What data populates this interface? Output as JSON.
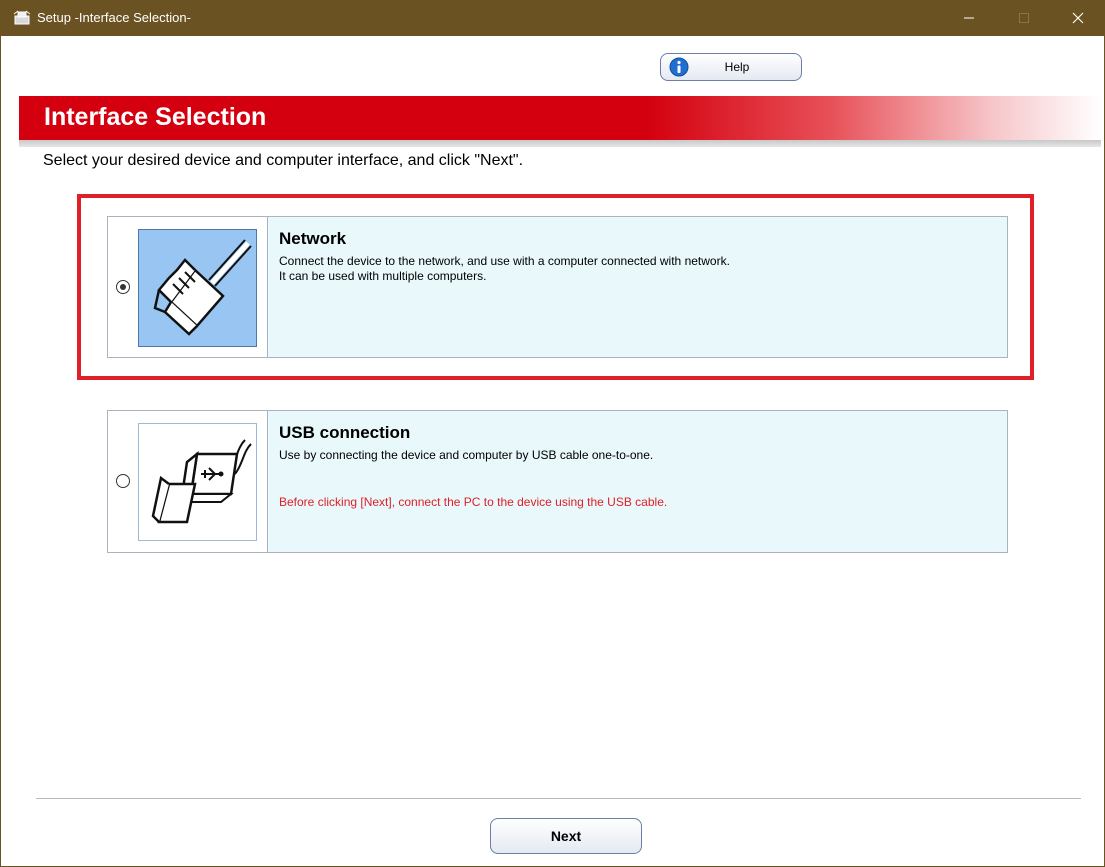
{
  "window": {
    "title": "Setup -Interface Selection-"
  },
  "toolbar": {
    "help_label": "Help"
  },
  "header": {
    "title": "Interface Selection"
  },
  "instruction": "Select your desired device and computer interface, and click \"Next\".",
  "options": [
    {
      "title": "Network",
      "description_lines": [
        "Connect the device to the network, and use with a computer connected with network.",
        "It can be used with multiple computers."
      ],
      "selected": true,
      "icon": "network-cable-icon"
    },
    {
      "title": "USB connection",
      "description_lines": [
        "Use by connecting the device and computer by USB cable one-to-one."
      ],
      "warning": "Before clicking [Next], connect the PC to the device using the USB cable.",
      "selected": false,
      "icon": "usb-cable-icon"
    }
  ],
  "footer": {
    "next_label": "Next"
  },
  "colors": {
    "titlebar": "#6b5222",
    "header_red": "#d4000f",
    "highlight_border": "#e02029",
    "option_info_bg": "#e8f8fb",
    "warning_text": "#e02029"
  }
}
